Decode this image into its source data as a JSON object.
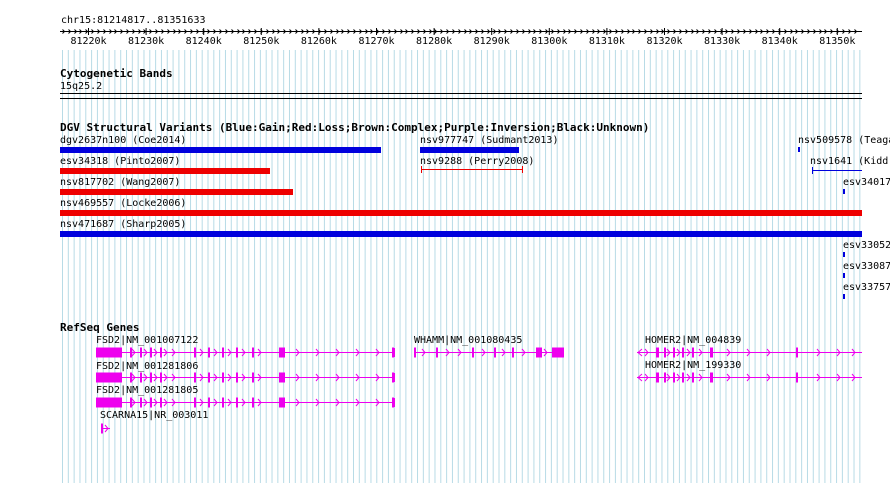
{
  "location": "chr15:81214817..81351633",
  "ruler": {
    "ticks": [
      "81220k",
      "81230k",
      "81240k",
      "81250k",
      "81260k",
      "81270k",
      "81280k",
      "81290k",
      "81300k",
      "81310k",
      "81320k",
      "81330k",
      "81340k",
      "81350k"
    ]
  },
  "cyto": {
    "title": "Cytogenetic Bands",
    "band": "15q25.2"
  },
  "dgv": {
    "title": "DGV Structural Variants (Blue:Gain;Red:Loss;Brown:Complex;Purple:Inversion;Black:Unknown)",
    "colors": {
      "gain": "#0000dd",
      "loss": "#ee0000"
    },
    "variants": [
      {
        "label": "dgv2637n100 (Coe2014)",
        "type": "gain"
      },
      {
        "label": "nsv977747 (Sudmant2013)",
        "type": "gain"
      },
      {
        "label": "nsv509578 (Teaga",
        "type": "gain"
      },
      {
        "label": "esv34318 (Pinto2007)",
        "type": "loss"
      },
      {
        "label": "nsv9288 (Perry2008)",
        "type": "loss"
      },
      {
        "label": "nsv1641 (Kidd",
        "type": "gain"
      },
      {
        "label": "nsv817702 (Wang2007)",
        "type": "loss"
      },
      {
        "label": "esv34017",
        "type": "gain"
      },
      {
        "label": "nsv469557 (Locke2006)",
        "type": "loss"
      },
      {
        "label": "nsv471687 (Sharp2005)",
        "type": "gain"
      },
      {
        "label": "esv33052",
        "type": "gain"
      },
      {
        "label": "esv33087",
        "type": "gain"
      },
      {
        "label": "esv33757",
        "type": "gain"
      }
    ]
  },
  "refseq": {
    "title": "RefSeq Genes",
    "color": "#ee00ee",
    "genes": [
      {
        "label": "FSD2|NM_001007122"
      },
      {
        "label": "FSD2|NM_001281806"
      },
      {
        "label": "FSD2|NM_001281805"
      },
      {
        "label": "SCARNA15|NR_003011"
      },
      {
        "label": "WHAMM|NM_001080435"
      },
      {
        "label": "HOMER2|NM_004839"
      },
      {
        "label": "HOMER2|NM_199330"
      }
    ]
  }
}
